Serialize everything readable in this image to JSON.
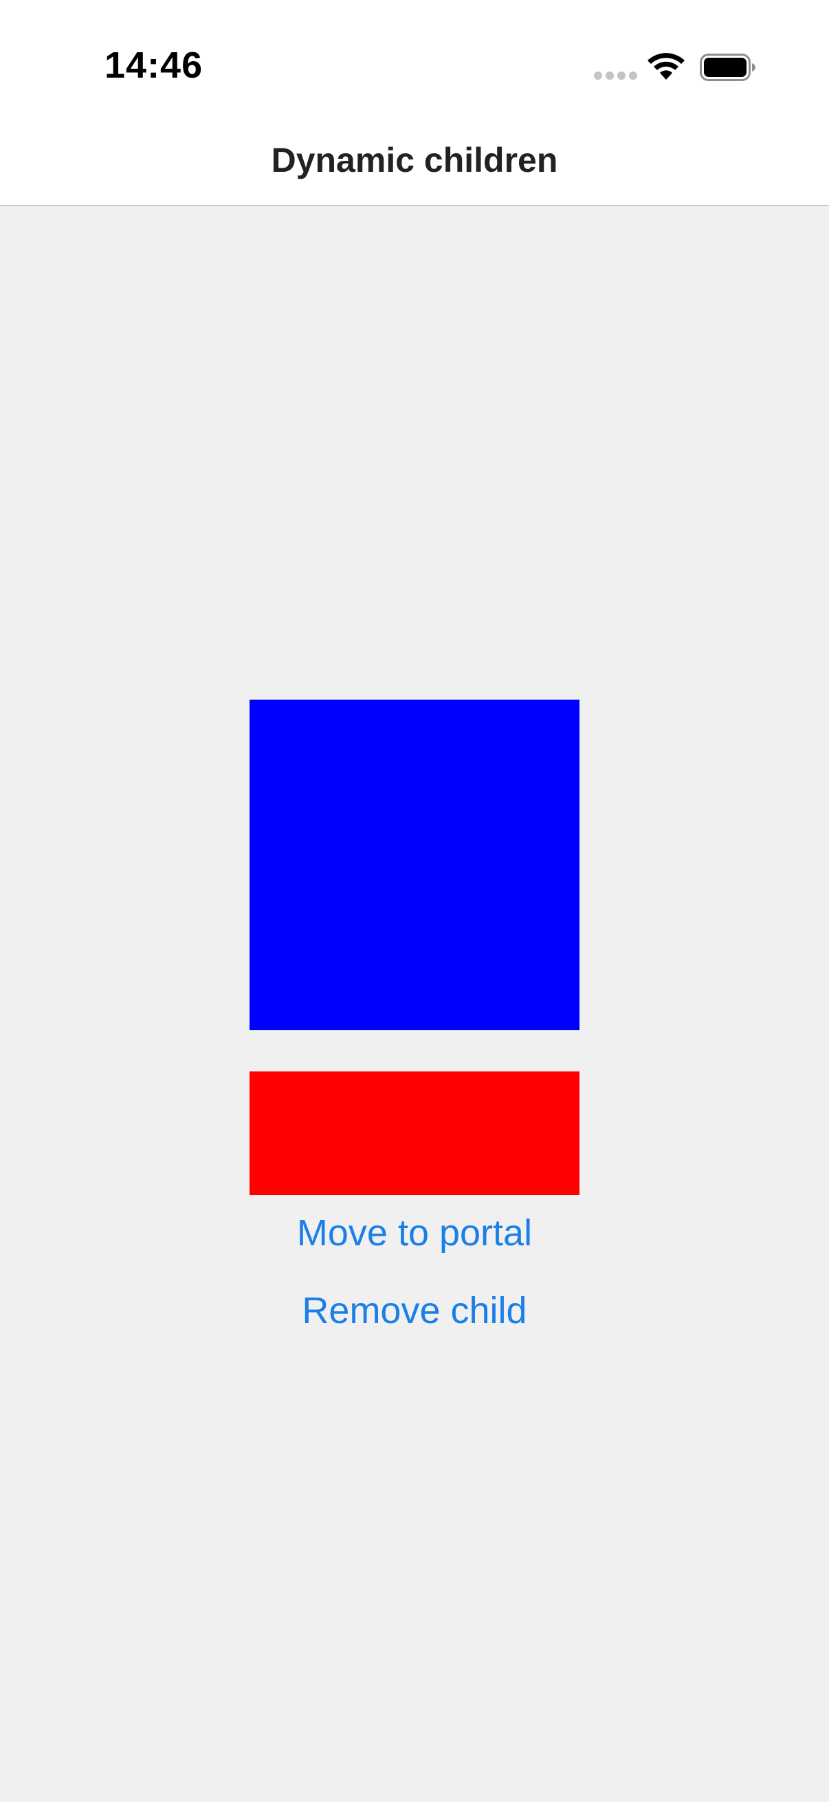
{
  "status_bar": {
    "time": "14:46",
    "icons": [
      "signal-dots-icon",
      "wifi-icon",
      "battery-icon"
    ]
  },
  "nav": {
    "title": "Dynamic children"
  },
  "content": {
    "blue_box_color": "#0000ff",
    "red_box_color": "#ff0000",
    "buttons": {
      "move_to_portal": "Move to portal",
      "remove_child": "Remove child"
    },
    "link_color": "#1a7fe6"
  }
}
